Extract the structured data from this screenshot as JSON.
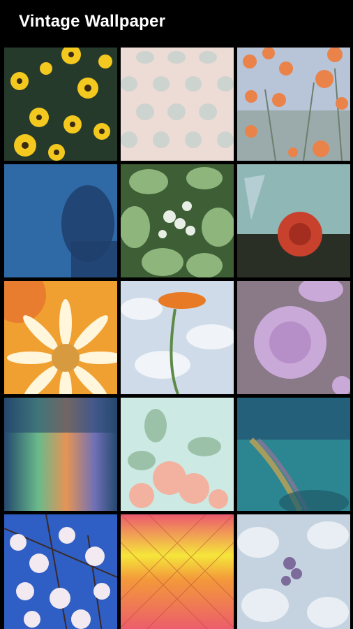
{
  "app_bar": {
    "title": "Vintage Wallpaper"
  },
  "wallpapers": [
    {
      "icon": "yellow-daisies-thumbnail",
      "colors": [
        "#1d2a22",
        "#f3c81f",
        "#2f4a36"
      ]
    },
    {
      "icon": "polka-dot-pattern-thumbnail",
      "colors": [
        "#eddcd5",
        "#c8d2cd"
      ]
    },
    {
      "icon": "orange-wildflowers-thumbnail",
      "colors": [
        "#b8c4d8",
        "#e9834a",
        "#8ea19a"
      ]
    },
    {
      "icon": "blue-silhouette-thumbnail",
      "colors": [
        "#2f6aa6",
        "#1e3f6c"
      ]
    },
    {
      "icon": "green-leaves-thumbnail",
      "colors": [
        "#3e5e35",
        "#8eb57c",
        "#e7eee6"
      ]
    },
    {
      "icon": "red-rose-thumbnail",
      "colors": [
        "#8fb7b5",
        "#c8412d",
        "#2a2f26"
      ]
    },
    {
      "icon": "white-daisy-sunset-thumbnail",
      "colors": [
        "#f0a030",
        "#fff6dc",
        "#d89a3e"
      ]
    },
    {
      "icon": "orange-flower-sky-thumbnail",
      "colors": [
        "#cfdbe8",
        "#e87a25",
        "#5d8a46"
      ]
    },
    {
      "icon": "lilac-peony-thumbnail",
      "colors": [
        "#8a7a88",
        "#c9a9d8",
        "#b78fc8"
      ]
    },
    {
      "icon": "rainbow-haze-thumbnail",
      "colors": [
        "#24486e",
        "#69b98b",
        "#e59456"
      ]
    },
    {
      "icon": "peach-blossom-mint-thumbnail",
      "colors": [
        "#cde9e3",
        "#f3b2a0",
        "#8fb89a"
      ]
    },
    {
      "icon": "teal-rainbow-thumbnail",
      "colors": [
        "#24607a",
        "#2c8692",
        "#d9a64a"
      ]
    },
    {
      "icon": "cherry-blossom-sky-thumbnail",
      "colors": [
        "#2f5fc4",
        "#f2e9f1",
        "#3a2a28"
      ]
    },
    {
      "icon": "sunset-fence-thumbnail",
      "colors": [
        "#f5e63a",
        "#ec5a6e",
        "#f39a3a"
      ]
    },
    {
      "icon": "frosted-flowers-thumbnail",
      "colors": [
        "#c5d3e0",
        "#7d6b9c",
        "#e8eef3"
      ]
    }
  ]
}
